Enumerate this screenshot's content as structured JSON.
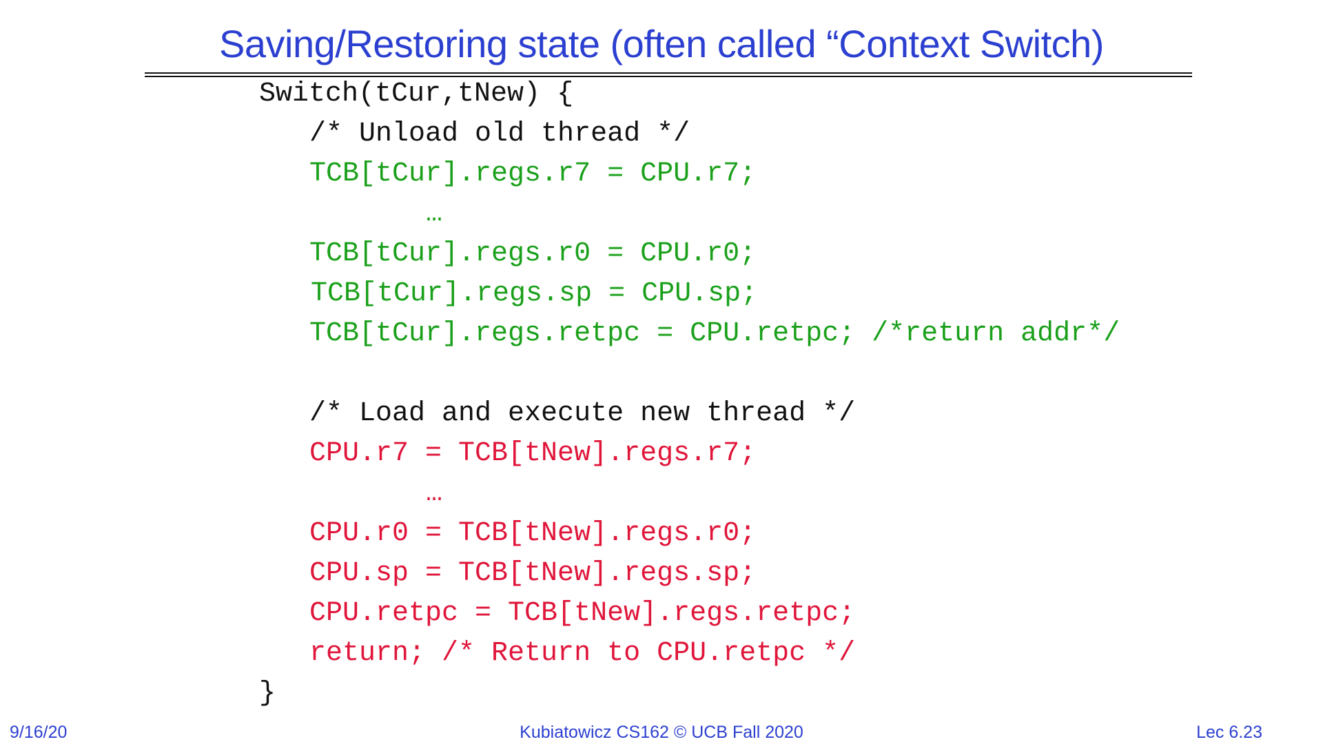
{
  "slide": {
    "title": "Saving/Restoring state (often called “Context Switch)"
  },
  "colors": {
    "title": "#2b3fd0",
    "code_default": "#111111",
    "code_save": "#1aa01a",
    "code_load": "#e0153a"
  },
  "code": {
    "lines": [
      "Switch(tCur,tNew) {",
      "/* Unload old thread */",
      "TCB[tCur].regs.r7 = CPU.r7;",
      "…",
      "TCB[tCur].regs.r0 = CPU.r0;",
      "TCB[tCur].regs.sp = CPU.sp;",
      "TCB[tCur].regs.retpc = CPU.retpc; /*return addr*/",
      "/* Load and execute new thread */",
      "CPU.r7 = TCB[tNew].regs.r7;",
      "…",
      "CPU.r0 = TCB[tNew].regs.r0;",
      "CPU.sp = TCB[tNew].regs.sp;",
      "CPU.retpc = TCB[tNew].regs.retpc;",
      "return; /* Return to CPU.retpc */",
      "}"
    ]
  },
  "footer": {
    "date": "9/16/20",
    "course": "Kubiatowicz CS162 © UCB Fall 2020",
    "lecture": "Lec 6.23"
  }
}
